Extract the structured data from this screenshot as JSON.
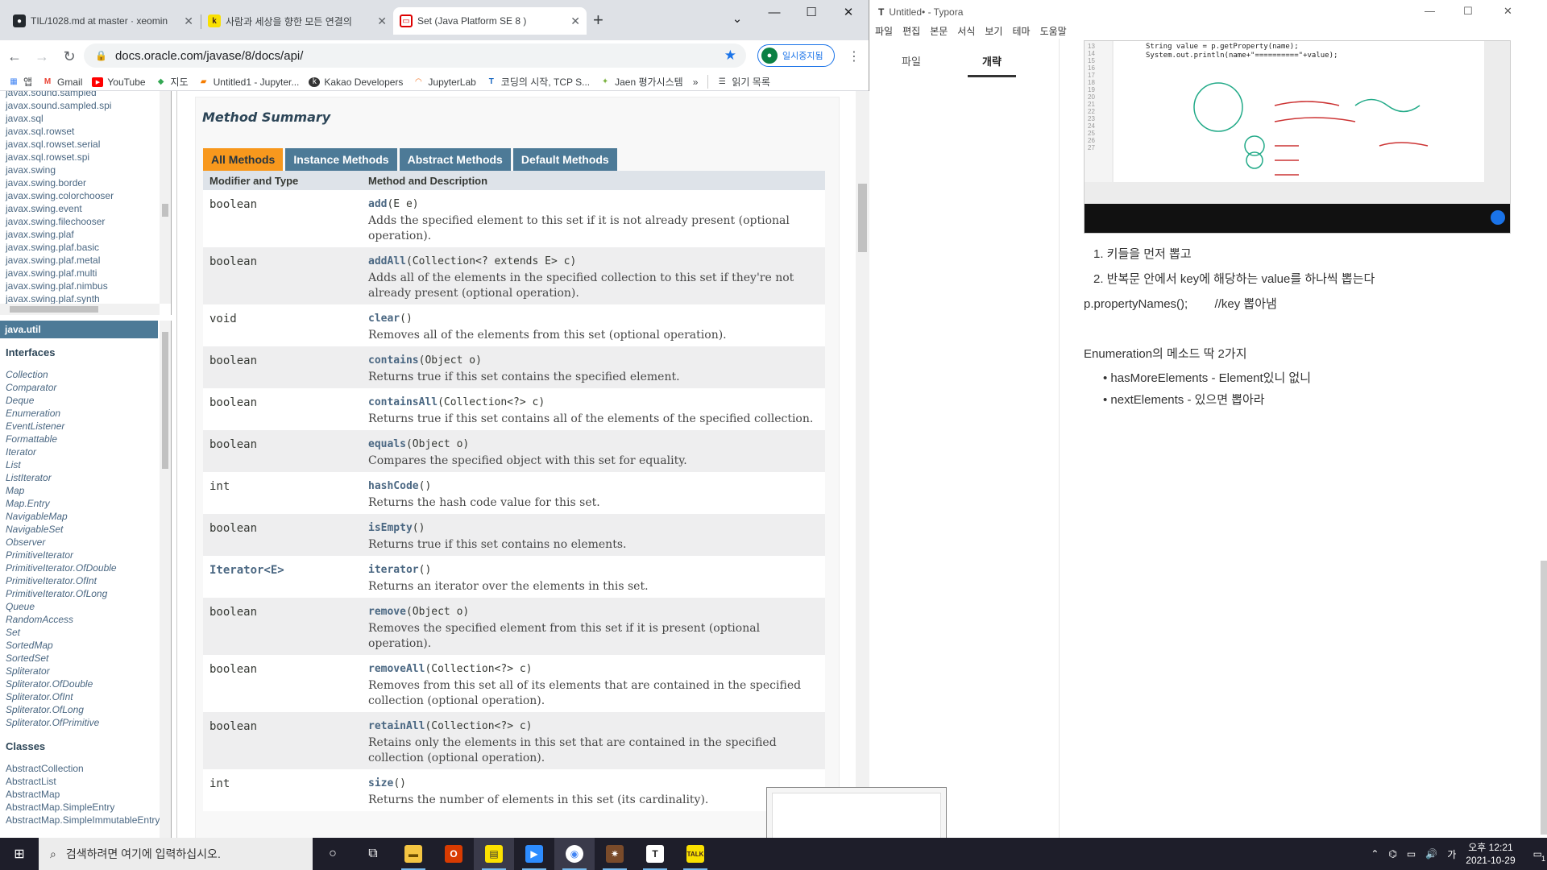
{
  "chrome": {
    "tabs": [
      {
        "title": "TIL/1028.md at master · xeomin",
        "icon": "github-icon",
        "active": false
      },
      {
        "title": "사람과 세상을 향한 모든 연결의",
        "icon": "kakao-icon",
        "active": false
      },
      {
        "title": "Set (Java Platform SE 8 )",
        "icon": "java-icon",
        "active": true
      }
    ],
    "url": "docs.oracle.com/javase/8/docs/api/",
    "profile_label": "일시중지됨",
    "bookmarks": [
      {
        "label": "앱",
        "icon": "apps-grid-icon"
      },
      {
        "label": "Gmail",
        "icon": "gmail-icon"
      },
      {
        "label": "YouTube",
        "icon": "youtube-icon"
      },
      {
        "label": "지도",
        "icon": "maps-icon"
      },
      {
        "label": "Untitled1 - Jupyter...",
        "icon": "jupyter-icon"
      },
      {
        "label": "Kakao Developers",
        "icon": "kakao-dev-icon"
      },
      {
        "label": "JupyterLab",
        "icon": "jupyterlab-icon"
      },
      {
        "label": "코딩의 시작, TCP S...",
        "icon": "tcp-icon"
      },
      {
        "label": "Jaen 평가시스템",
        "icon": "jaen-icon"
      },
      {
        "label": "»",
        "icon": "more-bookmarks-icon"
      },
      {
        "label": "읽기 목록",
        "icon": "reading-list-icon"
      }
    ]
  },
  "javadoc": {
    "packages": [
      "javax.sound.sampled",
      "javax.sound.sampled.spi",
      "javax.sql",
      "javax.sql.rowset",
      "javax.sql.rowset.serial",
      "javax.sql.rowset.spi",
      "javax.swing",
      "javax.swing.border",
      "javax.swing.colorchooser",
      "javax.swing.event",
      "javax.swing.filechooser",
      "javax.swing.plaf",
      "javax.swing.plaf.basic",
      "javax.swing.plaf.metal",
      "javax.swing.plaf.multi",
      "javax.swing.plaf.nimbus",
      "javax.swing.plaf.synth"
    ],
    "current_package": "java.util",
    "interfaces_heading": "Interfaces",
    "interfaces": [
      "Collection",
      "Comparator",
      "Deque",
      "Enumeration",
      "EventListener",
      "Formattable",
      "Iterator",
      "List",
      "ListIterator",
      "Map",
      "Map.Entry",
      "NavigableMap",
      "NavigableSet",
      "Observer",
      "PrimitiveIterator",
      "PrimitiveIterator.OfDouble",
      "PrimitiveIterator.OfInt",
      "PrimitiveIterator.OfLong",
      "Queue",
      "RandomAccess",
      "Set",
      "SortedMap",
      "SortedSet",
      "Spliterator",
      "Spliterator.OfDouble",
      "Spliterator.OfInt",
      "Spliterator.OfLong",
      "Spliterator.OfPrimitive"
    ],
    "classes_heading": "Classes",
    "classes": [
      "AbstractCollection",
      "AbstractList",
      "AbstractMap",
      "AbstractMap.SimpleEntry",
      "AbstractMap.SimpleImmutableEntry"
    ],
    "summary_title": "Method Summary",
    "method_tabs": [
      "All Methods",
      "Instance Methods",
      "Abstract Methods",
      "Default Methods"
    ],
    "col_modifier": "Modifier and Type",
    "col_method": "Method and Description",
    "methods": [
      {
        "type": "boolean",
        "name": "add",
        "params": "(E e)",
        "desc": "Adds the specified element to this set if it is not already present (optional operation)."
      },
      {
        "type": "boolean",
        "name": "addAll",
        "params": "(Collection<? extends E> c)",
        "desc": "Adds all of the elements in the specified collection to this set if they're not already present (optional operation)."
      },
      {
        "type": "void",
        "name": "clear",
        "params": "()",
        "desc": "Removes all of the elements from this set (optional operation)."
      },
      {
        "type": "boolean",
        "name": "contains",
        "params": "(Object o)",
        "desc": "Returns true if this set contains the specified element."
      },
      {
        "type": "boolean",
        "name": "containsAll",
        "params": "(Collection<?> c)",
        "desc": "Returns true if this set contains all of the elements of the specified collection."
      },
      {
        "type": "boolean",
        "name": "equals",
        "params": "(Object o)",
        "desc": "Compares the specified object with this set for equality."
      },
      {
        "type": "int",
        "name": "hashCode",
        "params": "()",
        "desc": "Returns the hash code value for this set."
      },
      {
        "type": "boolean",
        "name": "isEmpty",
        "params": "()",
        "desc": "Returns true if this set contains no elements."
      },
      {
        "type": "Iterator<E>",
        "name": "iterator",
        "params": "()",
        "desc": "Returns an iterator over the elements in this set."
      },
      {
        "type": "boolean",
        "name": "remove",
        "params": "(Object o)",
        "desc": "Removes the specified element from this set if it is present (optional operation)."
      },
      {
        "type": "boolean",
        "name": "removeAll",
        "params": "(Collection<?> c)",
        "desc": "Removes from this set all of its elements that are contained in the specified collection (optional operation)."
      },
      {
        "type": "boolean",
        "name": "retainAll",
        "params": "(Collection<?> c)",
        "desc": "Retains only the elements in this set that are contained in the specified collection (optional operation)."
      },
      {
        "type": "int",
        "name": "size",
        "params": "()",
        "desc": "Returns the number of elements in this set (its cardinality)."
      }
    ]
  },
  "typora": {
    "title": "Untitled• - Typora",
    "menu": [
      "파일",
      "편집",
      "본문",
      "서식",
      "보기",
      "테마",
      "도움말"
    ],
    "side_tabs": [
      "파일",
      "개략"
    ],
    "code_line1": "String value = p.getProperty(name);",
    "code_line2": "System.out.println(name+\"==========\"+value);",
    "list1": "1. 키들을 먼저 뽑고",
    "list2": "2. 반복문 안에서 key에 해당하는 value를 하나씩 뽑는다",
    "code_note": "p.propertyNames();        //key 뽑아냄",
    "enum_heading": "Enumeration의 메소드 딱 2가지",
    "bullets": [
      "hasMoreElements - Element있니 없니",
      "nextElements - 있으면 뽑아라"
    ]
  },
  "taskbar": {
    "search_placeholder": "검색하려면 여기에 입력하십시오.",
    "clock_time": "오후 12:21",
    "clock_date": "2021-10-29",
    "notification_count": "1",
    "apps": [
      "cortana-icon",
      "task-view-icon",
      "file-explorer-icon",
      "office-icon",
      "sticky-notes-icon",
      "zoom-icon",
      "chrome-icon",
      "game-icon",
      "typora-icon",
      "kakaotalk-icon"
    ]
  },
  "colors": {
    "javadoc_nav": "#4d7a97",
    "javadoc_active_tab": "#f8981d",
    "chrome_accent": "#1a73e8"
  }
}
